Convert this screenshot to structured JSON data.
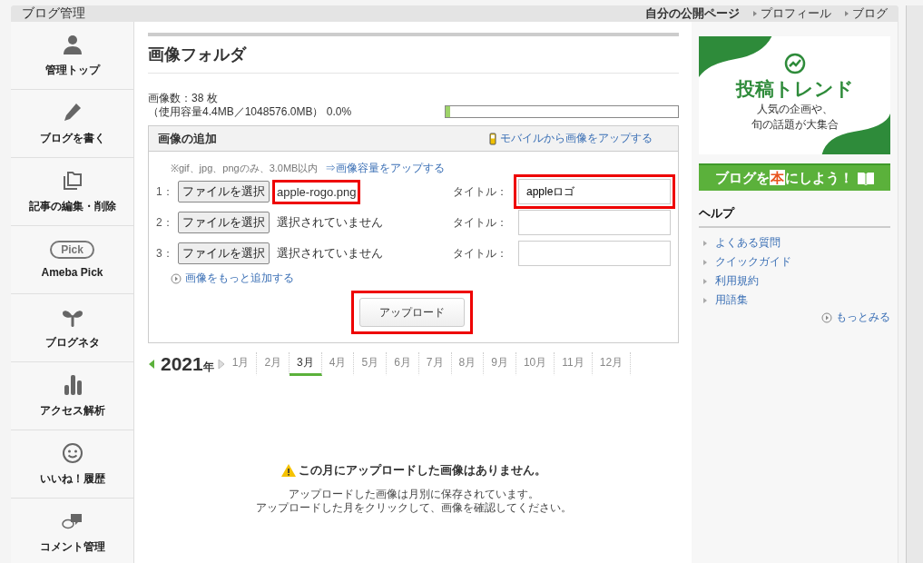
{
  "header": {
    "title": "ブログ管理",
    "links": [
      {
        "label": "自分の公開ページ",
        "bullet": false
      },
      {
        "label": "プロフィール",
        "bullet": true
      },
      {
        "label": "ブログ",
        "bullet": true
      }
    ]
  },
  "sidebar": {
    "items": [
      {
        "kind": "person",
        "label": "管理トップ"
      },
      {
        "kind": "pencil",
        "label": "ブログを書く"
      },
      {
        "kind": "folders",
        "label": "記事の編集・削除"
      },
      {
        "kind": "pill",
        "pill_text": "Pick",
        "label": "Ameba Pick"
      },
      {
        "kind": "sprout",
        "label": "ブログネタ"
      },
      {
        "kind": "bars",
        "label": "アクセス解析"
      },
      {
        "kind": "smile",
        "label": "いいね！履歴"
      },
      {
        "kind": "chat",
        "label": "コメント管理"
      }
    ]
  },
  "main": {
    "title": "画像フォルダ",
    "count": "画像数：38 枚",
    "usage": "（使用容量4.4MB／1048576.0MB） 0.0%",
    "usage_bar": {
      "level": 0.02
    },
    "upload": {
      "title": "画像の追加",
      "mobile_link": "モバイルから画像をアップする",
      "note": "※gif、jpg、pngのみ、3.0MB以内",
      "note_link": "⇒画像容量をアップする",
      "rows": [
        {
          "number": "1：",
          "button": "ファイルを選択",
          "file": "apple-rogo.png",
          "file_highlighted": true,
          "title_label": "タイトル：",
          "title_value": "appleロゴ",
          "title_highlighted": true
        },
        {
          "number": "2：",
          "button": "ファイルを選択",
          "file": "選択されていません",
          "file_highlighted": false,
          "title_label": "タイトル：",
          "title_value": "",
          "title_highlighted": false
        },
        {
          "number": "3：",
          "button": "ファイルを選択",
          "file": "選択されていません",
          "file_highlighted": false,
          "title_label": "タイトル：",
          "title_value": "",
          "title_highlighted": false
        }
      ],
      "more_link": "画像をもっと追加する",
      "upload_button": "アップロード",
      "upload_highlighted": true
    },
    "year": "2021",
    "year_suffix": "年",
    "months": [
      {
        "label": "1月",
        "selected": false
      },
      {
        "label": "2月",
        "selected": false
      },
      {
        "label": "3月",
        "selected": true
      },
      {
        "label": "4月",
        "selected": false
      },
      {
        "label": "5月",
        "selected": false
      },
      {
        "label": "6月",
        "selected": false
      },
      {
        "label": "7月",
        "selected": false
      },
      {
        "label": "8月",
        "selected": false
      },
      {
        "label": "9月",
        "selected": false
      },
      {
        "label": "10月",
        "selected": false
      },
      {
        "label": "11月",
        "selected": false
      },
      {
        "label": "12月",
        "selected": false
      }
    ],
    "empty_title": "この月にアップロードした画像はありません。",
    "empty_lines": [
      "アップロードした画像は月別に保存されています。",
      "アップロードした月をクリックして、画像を確認してください。"
    ]
  },
  "right": {
    "banner": {
      "title": "投稿トレンド",
      "lines": [
        "人気の企画や、",
        "旬の話題が大集合"
      ]
    },
    "book_banner": {
      "before": "ブログを",
      "boxed": "本",
      "after": "にしよう！"
    },
    "help": {
      "title": "ヘルプ",
      "items": [
        "よくある質問",
        "クイックガイド",
        "利用規約",
        "用語集"
      ],
      "more": "もっとみる"
    }
  }
}
